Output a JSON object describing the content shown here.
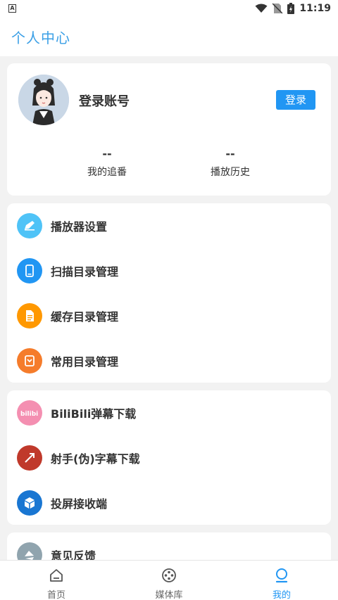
{
  "status_bar": {
    "time": "11:19",
    "notification_letter": "A"
  },
  "app_bar": {
    "title": "个人中心"
  },
  "profile": {
    "username": "登录账号",
    "login_label": "登录",
    "stats": [
      {
        "value": "--",
        "label": "我的追番"
      },
      {
        "value": "--",
        "label": "播放历史"
      }
    ]
  },
  "settings_group": {
    "items": [
      {
        "label": "播放器设置",
        "icon": "player-settings-icon",
        "color": "#4fc3f7"
      },
      {
        "label": "扫描目录管理",
        "icon": "scan-folder-icon",
        "color": "#2196f3"
      },
      {
        "label": "缓存目录管理",
        "icon": "cache-folder-icon",
        "color": "#ff9800"
      },
      {
        "label": "常用目录管理",
        "icon": "common-folder-icon",
        "color": "#f57c2b"
      }
    ]
  },
  "download_group": {
    "items": [
      {
        "label": "BiliBili弹幕下载",
        "icon": "bilibili-icon",
        "color": "#f48fb1"
      },
      {
        "label": "射手(伪)字幕下载",
        "icon": "shooter-icon",
        "color": "#c0392b"
      },
      {
        "label": "投屏接收端",
        "icon": "cast-receiver-icon",
        "color": "#1976d2"
      }
    ]
  },
  "feedback_group": {
    "items": [
      {
        "label": "意见反馈",
        "icon": "feedback-icon",
        "color": "#90a4ae"
      }
    ]
  },
  "bottom_nav": {
    "tabs": [
      {
        "label": "首页",
        "icon": "home-icon"
      },
      {
        "label": "媒体库",
        "icon": "media-library-icon"
      },
      {
        "label": "我的",
        "icon": "profile-icon",
        "active": true
      }
    ]
  }
}
